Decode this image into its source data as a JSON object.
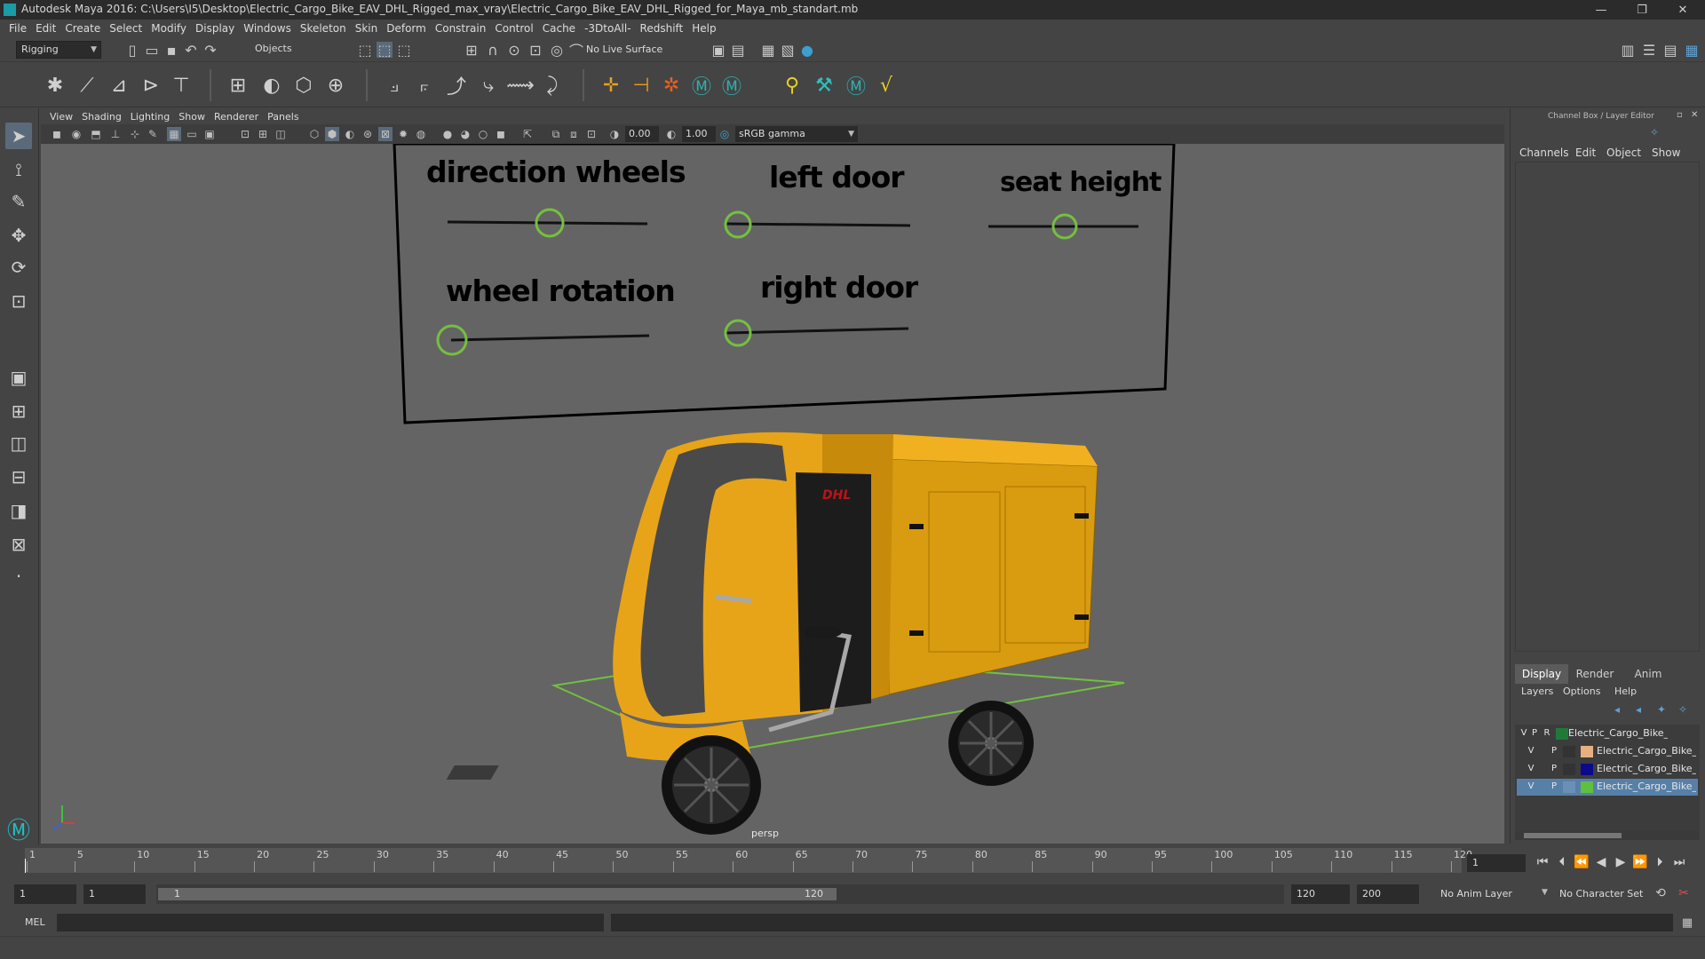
{
  "window": {
    "title": "Autodesk Maya 2016: C:\\Users\\I5\\Desktop\\Electric_Cargo_Bike_EAV_DHL_Rigged_max_vray\\Electric_Cargo_Bike_EAV_DHL_Rigged_for_Maya_mb_standart.mb",
    "minimize": "—",
    "restore": "❐",
    "close": "✕"
  },
  "menubar": [
    "File",
    "Edit",
    "Create",
    "Select",
    "Modify",
    "Display",
    "Windows",
    "Skeleton",
    "Skin",
    "Deform",
    "Constrain",
    "Control",
    "Cache",
    "-3DtoAll-",
    "Redshift",
    "Help"
  ],
  "statusline": {
    "menuset": "Rigging",
    "selection_mode": "Objects",
    "live_surface": "No Live Surface"
  },
  "panel": {
    "menus": [
      "View",
      "Shading",
      "Lighting",
      "Show",
      "Renderer",
      "Panels"
    ],
    "exposure": "0.00",
    "gamma": "1.00",
    "colorspace": "sRGB gamma",
    "camera_label": "persp"
  },
  "rig_board": {
    "labels": {
      "direction_wheels": "direction wheels",
      "left_door": "left door",
      "seat_height": "seat height",
      "wheel_rotation": "wheel rotation",
      "right_door": "right door"
    },
    "truck_logo": "DHL"
  },
  "channel_box": {
    "title": "Channel Box / Layer Editor",
    "menus": [
      "Channels",
      "Edit",
      "Object",
      "Show"
    ],
    "tabs": [
      "Display",
      "Render",
      "Anim"
    ],
    "layer_menus": [
      "Layers",
      "Options",
      "Help"
    ],
    "layers": [
      {
        "v": "V",
        "p": "P",
        "r": "R",
        "color": "#1f7a3a",
        "name": "Electric_Cargo_Bike_EAV_DHL"
      },
      {
        "v": "V",
        "p": "P",
        "r": "",
        "color": "#e8b080",
        "name": "Electric_Cargo_Bike_EAV_DHL"
      },
      {
        "v": "V",
        "p": "P",
        "r": "",
        "color": "#0a0a8a",
        "name": "Electric_Cargo_Bike_EAV_DHL"
      },
      {
        "v": "V",
        "p": "P",
        "r": "",
        "color": "#5fbf3f",
        "name": "Electric_Cargo_Bike_EAV_DHL"
      }
    ]
  },
  "timeline": {
    "ticks": [
      "1",
      "5",
      "10",
      "15",
      "20",
      "25",
      "30",
      "35",
      "40",
      "45",
      "50",
      "55",
      "60",
      "65",
      "70",
      "75",
      "80",
      "85",
      "90",
      "95",
      "100",
      "105",
      "110",
      "115",
      "120"
    ],
    "current_frame": "1"
  },
  "range": {
    "start": "1",
    "playback_start": "1",
    "slider_start": "1",
    "slider_end": "120",
    "playback_end": "120",
    "end": "200",
    "anim_layer": "No Anim Layer",
    "character_set": "No Character Set"
  },
  "command_line": {
    "lang": "MEL"
  }
}
